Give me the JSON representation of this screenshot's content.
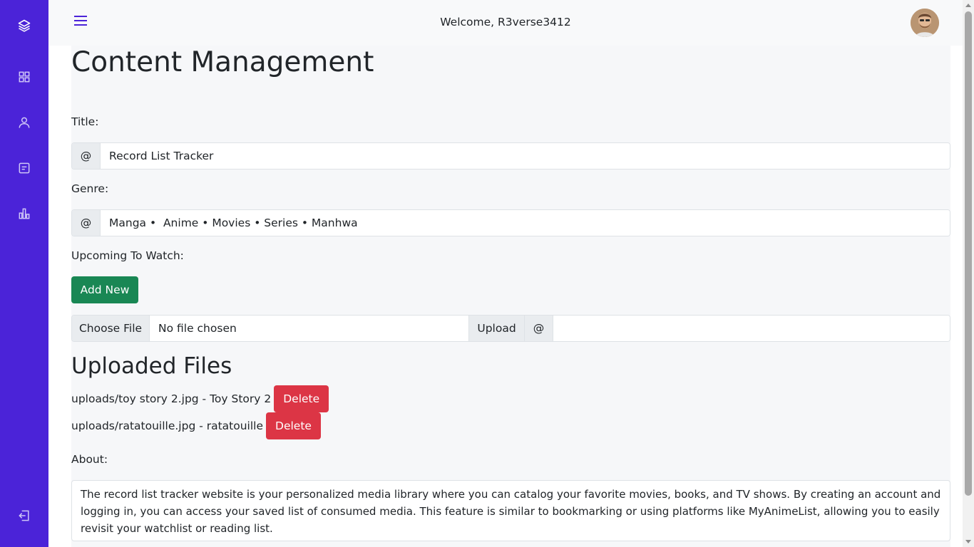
{
  "topbar": {
    "welcome_text": "Welcome, R3verse3412"
  },
  "sidebar": {
    "icons": [
      "layers-icon",
      "dashboard-grid-icon",
      "user-icon",
      "document-icon",
      "bar-chart-icon",
      "logout-icon"
    ]
  },
  "page": {
    "title": "Content Management"
  },
  "form": {
    "title_label": "Title:",
    "title_addon": "@",
    "title_value": "Record List Tracker",
    "genre_label": "Genre:",
    "genre_addon": "@",
    "genre_value": "Manga •  Anime • Movies • Series • Manhwa",
    "upcoming_label": "Upcoming To Watch:",
    "add_new_label": "Add New",
    "choose_file_label": "Choose File",
    "file_status": "No file chosen",
    "upload_label": "Upload",
    "upload_addon": "@"
  },
  "uploaded": {
    "heading": "Uploaded Files",
    "files": [
      {
        "text": "uploads/toy story 2.jpg - Toy Story 2",
        "delete_label": "Delete"
      },
      {
        "text": "uploads/ratatouille.jpg - ratatouille",
        "delete_label": "Delete"
      }
    ]
  },
  "about": {
    "label": "About:",
    "text": "The record list tracker website is your personalized media library where you can catalog your favorite movies, books, and TV shows. By creating an account and logging in, you can access your saved list of consumed media. This feature is similar to bookmarking or using platforms like MyAnimeList, allowing you to easily revisit your watchlist or reading list."
  },
  "colors": {
    "sidebar": "#4b23d8",
    "add_button": "#198754",
    "delete_button": "#dc3545"
  }
}
